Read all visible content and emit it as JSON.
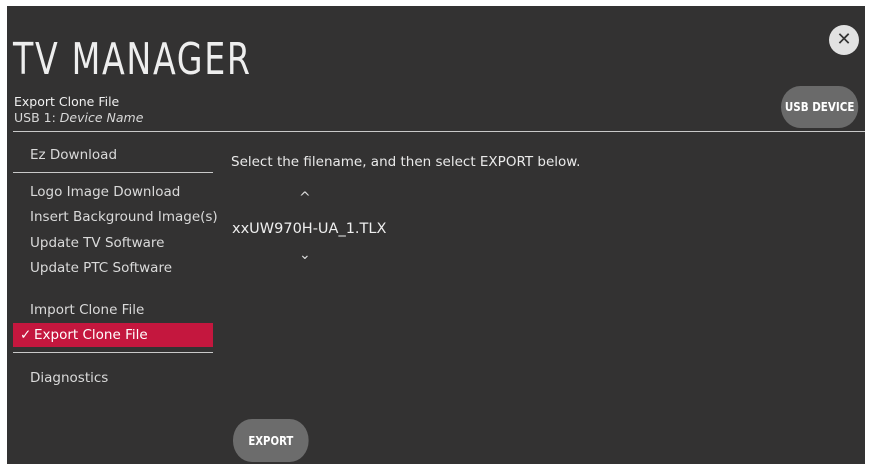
{
  "header": {
    "title": "TV MANAGER",
    "subtitle": "Export Clone File",
    "device_prefix": "USB 1:",
    "device_name": "Device Name",
    "usb_button": "USB DEVICE",
    "close_icon": "close-icon"
  },
  "menu": {
    "items": [
      {
        "label": "Ez Download"
      },
      {
        "label": "Logo Image Download"
      },
      {
        "label": "Insert Background Image(s)"
      },
      {
        "label": "Update TV Software"
      },
      {
        "label": "Update PTC Software"
      },
      {
        "label": "Import Clone File"
      },
      {
        "label": "Export Clone File",
        "selected": true
      },
      {
        "label": "Diagnostics"
      }
    ],
    "check_glyph": "✓"
  },
  "main": {
    "prompt": "Select the filename, and then select EXPORT below.",
    "filename": "xxUW970H-UA_1.TLX",
    "up_arrow": "^",
    "down_arrow": "⌄",
    "export_button": "EXPORT"
  },
  "colors": {
    "background": "#333232",
    "accent": "#c4173e",
    "button": "#6a6a6a"
  }
}
